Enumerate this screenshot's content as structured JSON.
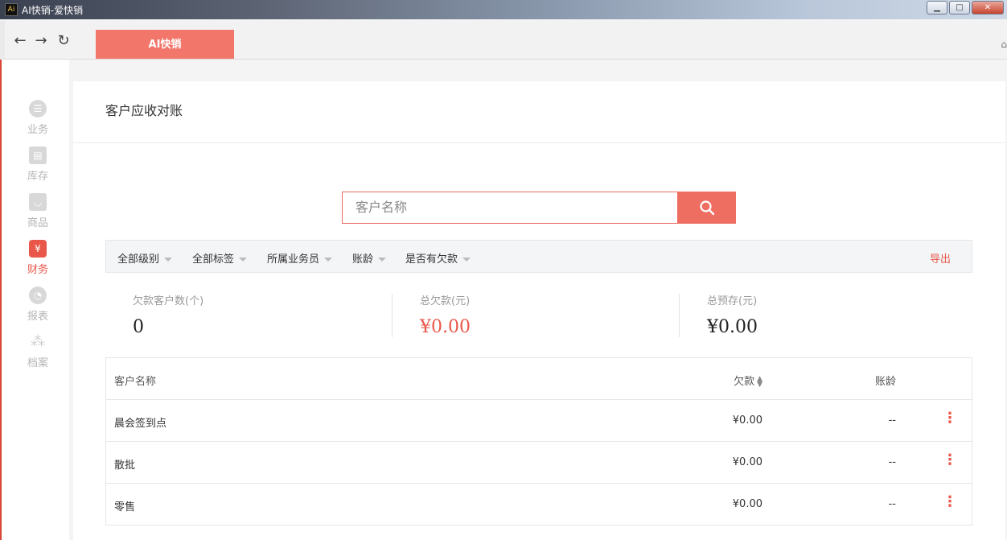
{
  "window": {
    "title": "AI快销-爱快销"
  },
  "browser": {
    "active_tab": "AI快销"
  },
  "sidebar": {
    "items": [
      {
        "label": "业务",
        "icon": "list-icon",
        "active": false
      },
      {
        "label": "库存",
        "icon": "inventory-icon",
        "active": false
      },
      {
        "label": "商品",
        "icon": "product-icon",
        "active": false
      },
      {
        "label": "财务",
        "icon": "finance-icon",
        "active": true
      },
      {
        "label": "报表",
        "icon": "pie-chart-icon",
        "active": false
      },
      {
        "label": "档案",
        "icon": "archive-icon",
        "active": false
      }
    ]
  },
  "page": {
    "title": "客户应收对账"
  },
  "search": {
    "placeholder": "客户名称"
  },
  "filters": {
    "level": "全部级别",
    "tag": "全部标签",
    "salesman": "所属业务员",
    "aging": "账龄",
    "has_debt": "是否有欠款",
    "export": "导出"
  },
  "stats": {
    "debt_customers_label": "欠款客户数(个)",
    "debt_customers_value": "0",
    "total_debt_label": "总欠款(元)",
    "total_debt_value": "¥0.00",
    "total_prepaid_label": "总预存(元)",
    "total_prepaid_value": "¥0.00"
  },
  "table": {
    "headers": {
      "name": "客户名称",
      "debt": "欠款",
      "aging": "账龄"
    },
    "rows": [
      {
        "name": "晨会签到点",
        "debt": "¥0.00",
        "aging": "--"
      },
      {
        "name": "散批",
        "debt": "¥0.00",
        "aging": "--"
      },
      {
        "name": "零售",
        "debt": "¥0.00",
        "aging": "--"
      }
    ]
  },
  "colors": {
    "accent": "#ef6e62",
    "active_red": "#e8574a"
  }
}
